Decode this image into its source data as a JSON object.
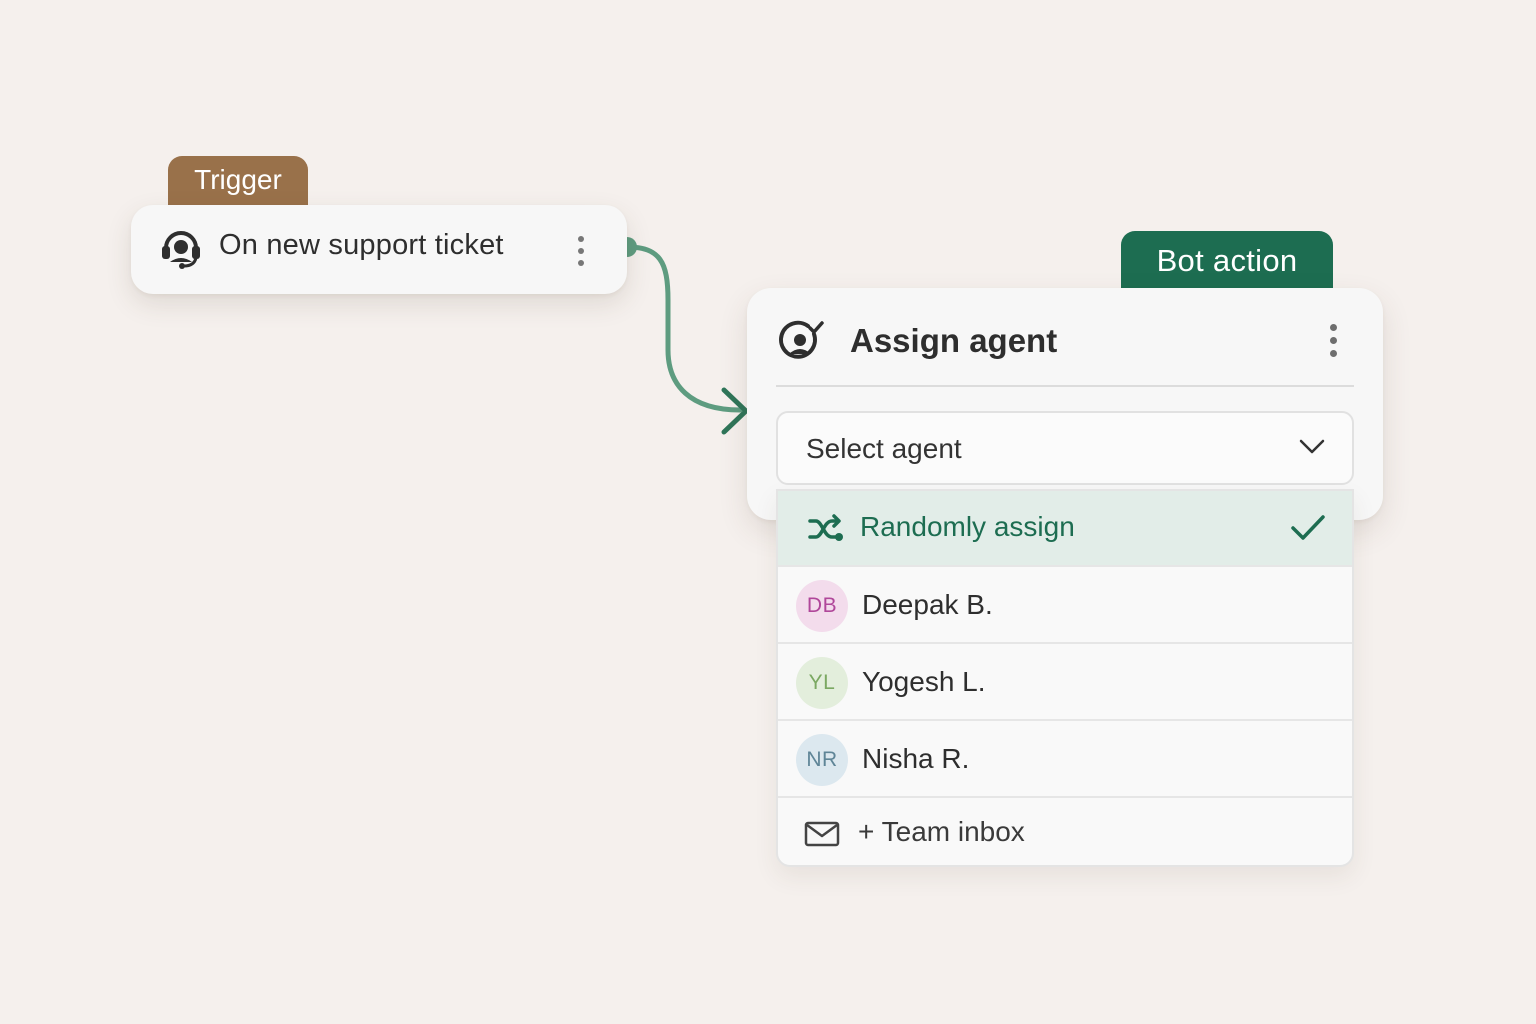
{
  "trigger": {
    "tag": "Trigger",
    "title": "On new support ticket",
    "icon": "headset-icon",
    "tag_color": "#99714a"
  },
  "bot_action": {
    "tag": "Bot action",
    "title": "Assign agent",
    "icon": "assign-agent-icon",
    "tag_color": "#1d6d51",
    "select": {
      "label": "Select agent"
    },
    "options": [
      {
        "label": "Randomly assign",
        "icon": "shuffle-icon",
        "selected": true
      },
      {
        "label": "Deepak B.",
        "initials": "DB",
        "avatar_bg": "#f3dcec",
        "avatar_fg": "#b0479a"
      },
      {
        "label": "Yogesh L.",
        "initials": "YL",
        "avatar_bg": "#e3eedc",
        "avatar_fg": "#7ba862"
      },
      {
        "label": "Nisha R.",
        "initials": "NR",
        "avatar_bg": "#dce8ef",
        "avatar_fg": "#5f8597"
      },
      {
        "label": "+ Team inbox",
        "icon": "mail-icon"
      }
    ]
  },
  "colors": {
    "background": "#f5f0ed",
    "accent": "#1d6d51",
    "connector": "#5e9c80"
  }
}
